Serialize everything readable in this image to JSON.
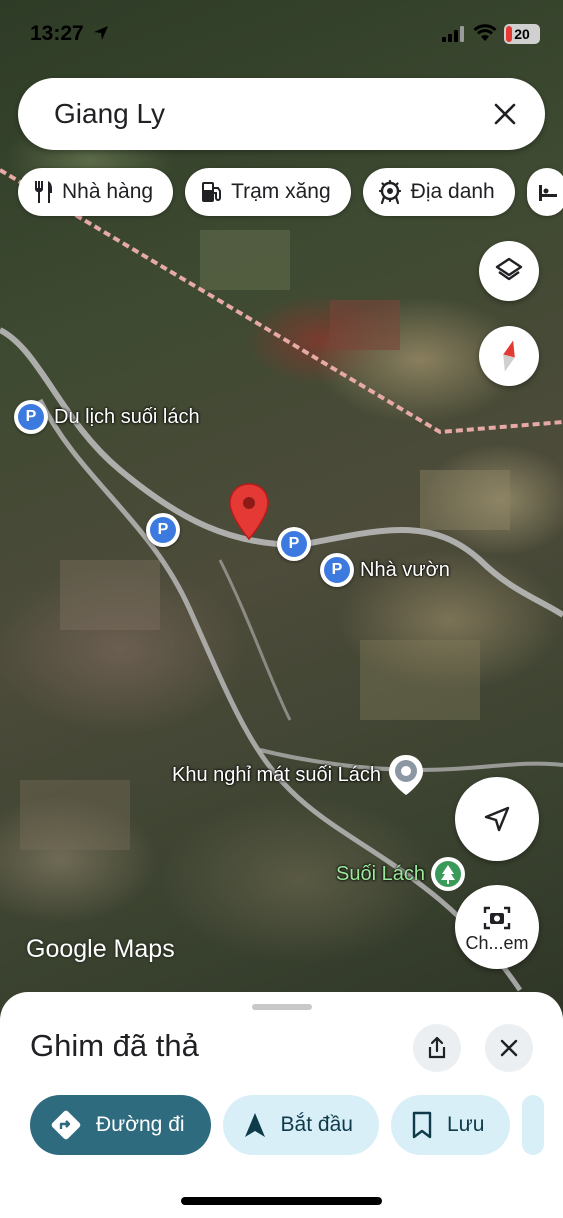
{
  "status_bar": {
    "time": "13:27",
    "battery": "20"
  },
  "search": {
    "query": "Giang Ly"
  },
  "chips": [
    {
      "label": "Nhà hàng",
      "icon": "restaurant-icon"
    },
    {
      "label": "Trạm xăng",
      "icon": "gas-station-icon"
    },
    {
      "label": "Địa danh",
      "icon": "landmark-icon"
    }
  ],
  "map": {
    "labels": {
      "poi_1": "Du lịch suối lách",
      "poi_2": "Nhà vườn",
      "poi_3": "Khu nghỉ mát suối Lách",
      "poi_4": "Suối Lách"
    },
    "watermark": "Google Maps"
  },
  "fab": {
    "street_view_label": "Ch...em"
  },
  "sheet": {
    "title": "Ghim đã thả",
    "actions": {
      "directions": "Đường đi",
      "start": "Bắt đầu",
      "save": "Lưu"
    }
  },
  "colors": {
    "pin": "#e53935",
    "primary": "#2f6b7e",
    "secondary": "#d8eff7",
    "poi_blue": "#3d7ae0"
  }
}
